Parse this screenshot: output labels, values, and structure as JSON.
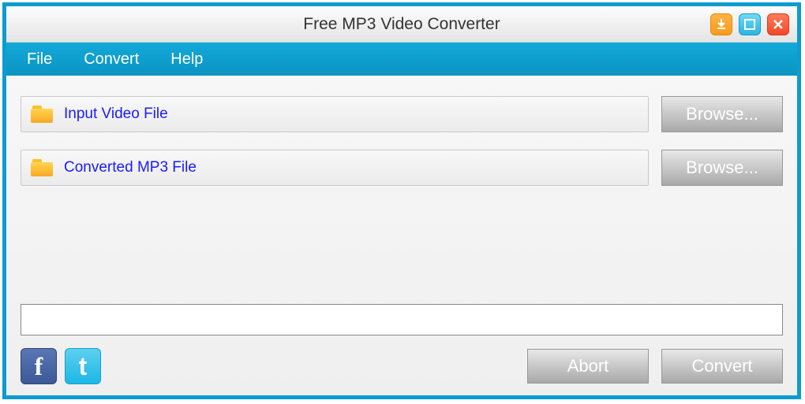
{
  "title": "Free MP3 Video Converter",
  "menu": {
    "file": "File",
    "convert": "Convert",
    "help": "Help"
  },
  "fields": {
    "input": {
      "label": "Input Video File"
    },
    "output": {
      "label": "Converted MP3 File"
    }
  },
  "buttons": {
    "browse": "Browse...",
    "abort": "Abort",
    "convert": "Convert"
  }
}
